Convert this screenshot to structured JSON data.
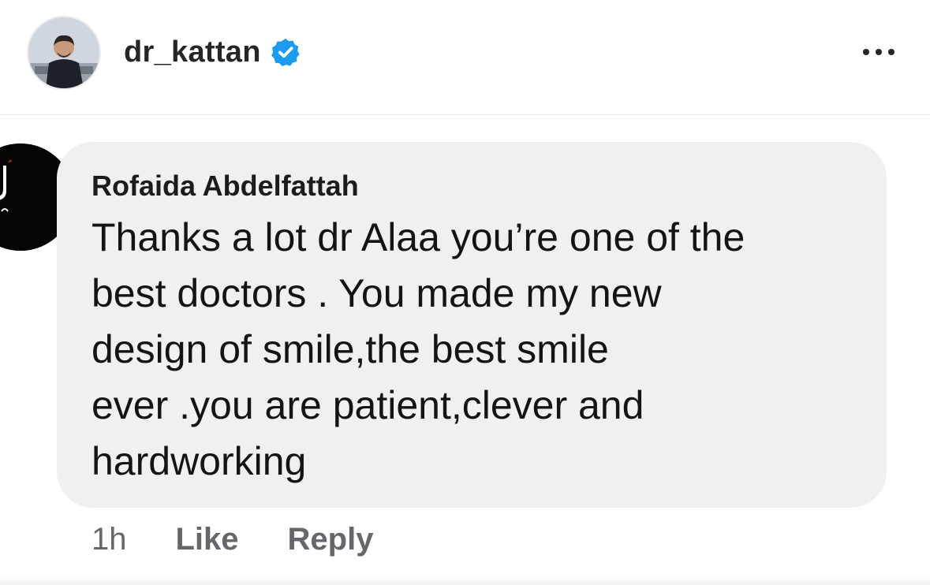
{
  "header": {
    "username": "dr_kattan",
    "verified_icon": "verified-badge-icon",
    "more_icon": "more-horizontal-icon",
    "accent_color": "#1d9bf0"
  },
  "comment": {
    "author": "Rofaida Abdelfattah",
    "text_lines": [
      "Thanks a lot dr Alaa you’re one of the",
      "best doctors . You made my new",
      "design of smile,the best smile",
      "ever .you are patient,clever and",
      "hardworking"
    ],
    "timestamp": "1h",
    "like_label": "Like",
    "reply_label": "Reply",
    "bubble_color": "#f0f0f3"
  }
}
